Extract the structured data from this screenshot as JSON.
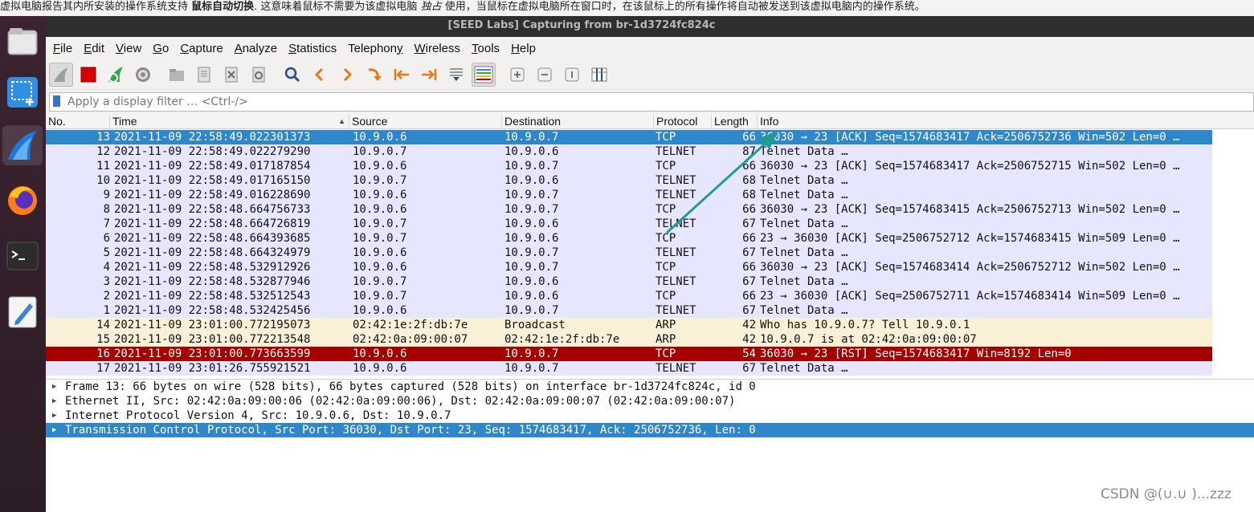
{
  "banner": {
    "text_a": "虚拟电脑报告其内所安装的操作系统支持",
    "bold": "鼠标自动切换",
    "text_b": ". 这意味着鼠标不需要为该虚拟电脑",
    "italic": "独占",
    "text_c": "使用，当鼠标在虚拟电脑所在窗口时，在该鼠标上的所有操作将自动被发送到该虚拟电脑内的操作系统。"
  },
  "window": {
    "title": "[SEED Labs] Capturing from br-1d3724fc824c"
  },
  "dock": {
    "items": [
      "files-icon",
      "screenshot-icon",
      "wireshark-icon",
      "firefox-icon",
      "terminal-icon",
      "text-editor-icon"
    ]
  },
  "menu": [
    {
      "u": "F",
      "rest": "ile"
    },
    {
      "u": "E",
      "rest": "dit"
    },
    {
      "u": "V",
      "rest": "iew"
    },
    {
      "u": "G",
      "rest": "o"
    },
    {
      "u": "C",
      "rest": "apture"
    },
    {
      "u": "A",
      "rest": "nalyze"
    },
    {
      "u": "S",
      "rest": "tatistics"
    },
    {
      "u": "",
      "rest": "Telephon",
      "u2": "y"
    },
    {
      "u": "W",
      "rest": "ireless"
    },
    {
      "u": "T",
      "rest": "ools"
    },
    {
      "u": "H",
      "rest": "elp"
    }
  ],
  "filter": {
    "placeholder": "Apply a display filter … <Ctrl-/>"
  },
  "columns": [
    "No.",
    "Time",
    "Source",
    "Destination",
    "Protocol",
    "Length",
    "Info"
  ],
  "packets": [
    {
      "no": "13",
      "time": "2021-11-09 22:58:49.022301373",
      "src": "10.9.0.6",
      "dst": "10.9.0.7",
      "proto": "TCP",
      "len": "66",
      "info": "36030 → 23 [ACK] Seq=1574683417 Ack=2506752736 Win=502 Len=0 …",
      "style": "selected"
    },
    {
      "no": "12",
      "time": "2021-11-09 22:58:49.022279290",
      "src": "10.9.0.7",
      "dst": "10.9.0.6",
      "proto": "TELNET",
      "len": "87",
      "info": "Telnet Data …",
      "style": "tcp"
    },
    {
      "no": "11",
      "time": "2021-11-09 22:58:49.017187854",
      "src": "10.9.0.6",
      "dst": "10.9.0.7",
      "proto": "TCP",
      "len": "66",
      "info": "36030 → 23 [ACK] Seq=1574683417 Ack=2506752715 Win=502 Len=0 …",
      "style": "tcp"
    },
    {
      "no": "10",
      "time": "2021-11-09 22:58:49.017165150",
      "src": "10.9.0.7",
      "dst": "10.9.0.6",
      "proto": "TELNET",
      "len": "68",
      "info": "Telnet Data …",
      "style": "tcp"
    },
    {
      "no": "9",
      "time": "2021-11-09 22:58:49.016228690",
      "src": "10.9.0.6",
      "dst": "10.9.0.7",
      "proto": "TELNET",
      "len": "68",
      "info": "Telnet Data …",
      "style": "tcp"
    },
    {
      "no": "8",
      "time": "2021-11-09 22:58:48.664756733",
      "src": "10.9.0.6",
      "dst": "10.9.0.7",
      "proto": "TCP",
      "len": "66",
      "info": "36030 → 23 [ACK] Seq=1574683415 Ack=2506752713 Win=502 Len=0 …",
      "style": "tcp"
    },
    {
      "no": "7",
      "time": "2021-11-09 22:58:48.664726819",
      "src": "10.9.0.7",
      "dst": "10.9.0.6",
      "proto": "TELNET",
      "len": "67",
      "info": "Telnet Data …",
      "style": "tcp"
    },
    {
      "no": "6",
      "time": "2021-11-09 22:58:48.664393685",
      "src": "10.9.0.7",
      "dst": "10.9.0.6",
      "proto": "TCP",
      "len": "66",
      "info": "23 → 36030 [ACK] Seq=2506752712 Ack=1574683415 Win=509 Len=0 …",
      "style": "tcp"
    },
    {
      "no": "5",
      "time": "2021-11-09 22:58:48.664324979",
      "src": "10.9.0.6",
      "dst": "10.9.0.7",
      "proto": "TELNET",
      "len": "67",
      "info": "Telnet Data …",
      "style": "tcp"
    },
    {
      "no": "4",
      "time": "2021-11-09 22:58:48.532912926",
      "src": "10.9.0.6",
      "dst": "10.9.0.7",
      "proto": "TCP",
      "len": "66",
      "info": "36030 → 23 [ACK] Seq=1574683414 Ack=2506752712 Win=502 Len=0 …",
      "style": "tcp"
    },
    {
      "no": "3",
      "time": "2021-11-09 22:58:48.532877946",
      "src": "10.9.0.7",
      "dst": "10.9.0.6",
      "proto": "TELNET",
      "len": "67",
      "info": "Telnet Data …",
      "style": "tcp"
    },
    {
      "no": "2",
      "time": "2021-11-09 22:58:48.532512543",
      "src": "10.9.0.7",
      "dst": "10.9.0.6",
      "proto": "TCP",
      "len": "66",
      "info": "23 → 36030 [ACK] Seq=2506752711 Ack=1574683414 Win=509 Len=0 …",
      "style": "tcp"
    },
    {
      "no": "1",
      "time": "2021-11-09 22:58:48.532425456",
      "src": "10.9.0.6",
      "dst": "10.9.0.7",
      "proto": "TELNET",
      "len": "67",
      "info": "Telnet Data …",
      "style": "tcp"
    },
    {
      "no": "14",
      "time": "2021-11-09 23:01:00.772195073",
      "src": "02:42:1e:2f:db:7e",
      "dst": "Broadcast",
      "proto": "ARP",
      "len": "42",
      "info": "Who has 10.9.0.7? Tell 10.9.0.1",
      "style": "arp"
    },
    {
      "no": "15",
      "time": "2021-11-09 23:01:00.772213548",
      "src": "02:42:0a:09:00:07",
      "dst": "02:42:1e:2f:db:7e",
      "proto": "ARP",
      "len": "42",
      "info": "10.9.0.7 is at 02:42:0a:09:00:07",
      "style": "arp"
    },
    {
      "no": "16",
      "time": "2021-11-09 23:01:00.773663599",
      "src": "10.9.0.6",
      "dst": "10.9.0.7",
      "proto": "TCP",
      "len": "54",
      "info": "36030 → 23 [RST] Seq=1574683417 Win=8192 Len=0",
      "style": "rst"
    },
    {
      "no": "17",
      "time": "2021-11-09 23:01:26.755921521",
      "src": "10.9.0.6",
      "dst": "10.9.0.7",
      "proto": "TELNET",
      "len": "67",
      "info": "Telnet Data …",
      "style": "tcp"
    }
  ],
  "details": [
    {
      "text": "Frame 13: 66 bytes on wire (528 bits), 66 bytes captured (528 bits) on interface br-1d3724fc824c, id 0",
      "selected": false
    },
    {
      "text": "Ethernet II, Src: 02:42:0a:09:00:06 (02:42:0a:09:00:06), Dst: 02:42:0a:09:00:07 (02:42:0a:09:00:07)",
      "selected": false
    },
    {
      "text": "Internet Protocol Version 4, Src: 10.9.0.6, Dst: 10.9.0.7",
      "selected": false
    },
    {
      "text": "Transmission Control Protocol, Src Port: 36030, Dst Port: 23, Seq: 1574683417, Ack: 2506752736, Len: 0",
      "selected": true
    }
  ],
  "colors": {
    "selected_row": "#2f86c8",
    "tcp_row": "#e7e6ff",
    "arp_row": "#faf0d7",
    "rst_row": "#a40000",
    "annotation_arrow": "#1f9a96"
  },
  "watermark": "CSDN @(∪.∪ )...zzz"
}
